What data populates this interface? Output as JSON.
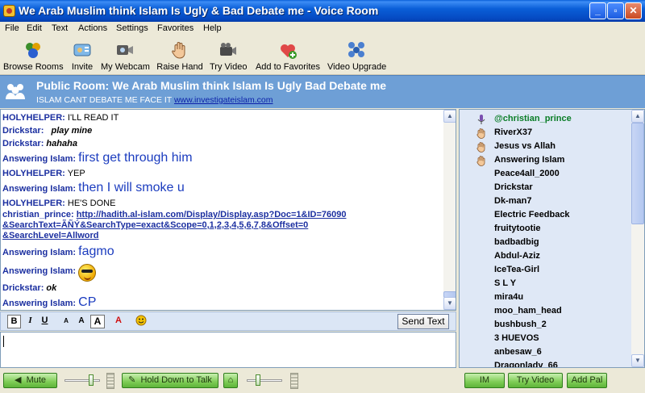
{
  "window": {
    "title": "We Arab Muslim think Islam Is Ugly & Bad Debate me - Voice Room",
    "buttons": {
      "minimize": "_",
      "maximize": "▫",
      "close": "✕"
    }
  },
  "menu": [
    "File",
    "Edit",
    "Text",
    "Actions",
    "Settings",
    "Favorites",
    "Help"
  ],
  "toolbar": [
    {
      "label": "Browse Rooms",
      "icon": "browse-rooms-icon"
    },
    {
      "label": "Invite",
      "icon": "invite-icon"
    },
    {
      "label": "My Webcam",
      "icon": "webcam-icon"
    },
    {
      "label": "Raise Hand",
      "icon": "raise-hand-icon"
    },
    {
      "label": "Try Video",
      "icon": "video-camera-icon"
    },
    {
      "label": "Add to Favorites",
      "icon": "add-favorites-icon"
    },
    {
      "label": "Video Upgrade",
      "icon": "video-upgrade-icon"
    }
  ],
  "room": {
    "title": "Public Room: We Arab Muslim think Islam Is Ugly  Bad Debate me",
    "topic": "ISLAM CANT DEBATE ME FACE IT",
    "topic_link": "www.investigateislam.com"
  },
  "messages": [
    {
      "nick": "HOLYHELPER:",
      "text": "I'LL READ IT",
      "style": "normal"
    },
    {
      "nick": "Drickstar:",
      "text": "play mine",
      "style": "italic"
    },
    {
      "nick": "Drickstar:",
      "text": "hahaha",
      "style": "italic"
    },
    {
      "nick": "Answering Islam:",
      "text": "first get through him",
      "style": "big"
    },
    {
      "nick": "HOLYHELPER:",
      "text": "YEP",
      "style": "normal"
    },
    {
      "nick": "Answering Islam:",
      "text": "then I will smoke u",
      "style": "big"
    },
    {
      "nick": "HOLYHELPER:",
      "text": "HE'S DONE",
      "style": "normal"
    },
    {
      "nick": "christian_prince:",
      "link_lines": [
        "http://hadith.al-islam.com/Display/Display.asp?Doc=1&ID=76090",
        "&SearchText=ÃÑÝ&SearchType=exact&Scope=0,1,2,3,4,5,6,7,8&Offset=0",
        "&SearchLevel=Allword"
      ],
      "style": "link"
    },
    {
      "nick": "Answering Islam:",
      "text": "fagmo",
      "style": "big"
    },
    {
      "nick": "Answering Islam:",
      "text": "",
      "style": "smiley",
      "icon": "cool-smiley-icon"
    },
    {
      "nick": "Drickstar:",
      "text": "ok",
      "style": "italic"
    },
    {
      "nick": "Answering Islam:",
      "text": "CP",
      "style": "big"
    }
  ],
  "format_bar": {
    "bold": "B",
    "italic": "I",
    "underline": "U",
    "font_small": "A",
    "font_medium": "A",
    "font_large": "A",
    "color": "A",
    "send_label": "Send Text"
  },
  "users": [
    {
      "name": "@christian_prince",
      "icon": "microphone-icon",
      "speaking": true
    },
    {
      "name": "RiverX37",
      "icon": "raised-hand-icon"
    },
    {
      "name": "Jesus vs Allah",
      "icon": "raised-hand-icon"
    },
    {
      "name": "Answering Islam",
      "icon": "raised-hand-icon"
    },
    {
      "name": "Peace4all_2000",
      "icon": ""
    },
    {
      "name": "Drickstar",
      "icon": ""
    },
    {
      "name": "Dk-man7",
      "icon": ""
    },
    {
      "name": "Electric Feedback",
      "icon": ""
    },
    {
      "name": "fruitytootie",
      "icon": ""
    },
    {
      "name": "badbadbig",
      "icon": ""
    },
    {
      "name": "Abdul-Aziz",
      "icon": ""
    },
    {
      "name": "IceTea-Girl",
      "icon": ""
    },
    {
      "name": "S L Y",
      "icon": ""
    },
    {
      "name": "mira4u",
      "icon": ""
    },
    {
      "name": "moo_ham_head",
      "icon": ""
    },
    {
      "name": "bushbush_2",
      "icon": ""
    },
    {
      "name": "3 HUEVOS",
      "icon": ""
    },
    {
      "name": "anbesaw_6",
      "icon": ""
    },
    {
      "name": "Dragonlady_66",
      "icon": ""
    }
  ],
  "bottom": {
    "mute_label": "Mute",
    "talk_label": "Hold Down to Talk",
    "im_label": "IM",
    "try_video_label": "Try Video",
    "add_pal_label": "Add Pal",
    "volume_level": 0.78,
    "mic_level": 0.3
  }
}
